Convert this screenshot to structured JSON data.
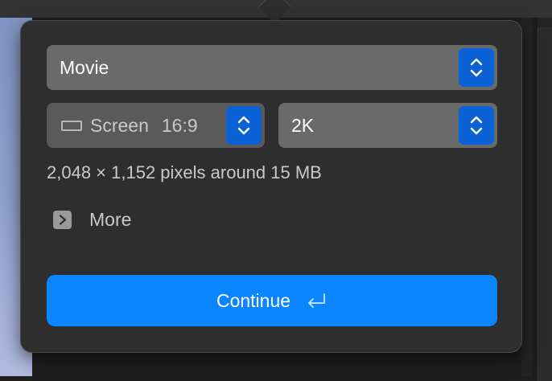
{
  "format": {
    "selected": "Movie"
  },
  "canvas": {
    "icon": "screen-icon",
    "label": "Screen",
    "aspect": "16:9"
  },
  "resolution": {
    "selected": "2K"
  },
  "info_text": "2,048 × 1,152 pixels around 15 MB",
  "more": {
    "label": "More",
    "icon": "disclosure-chevron-right-icon"
  },
  "continue_button": {
    "label": "Continue",
    "icon": "return-key-icon"
  },
  "colors": {
    "accent": "#0a84ff",
    "stepper": "#0a62d6",
    "popover_bg": "#2e2e2e",
    "field_bg": "#6a6a6a"
  }
}
